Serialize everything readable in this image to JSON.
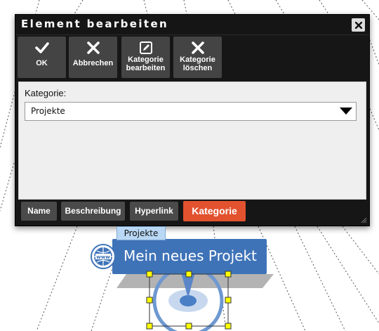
{
  "dialog": {
    "title": "Element bearbeiten",
    "toolbar": [
      {
        "label": "OK",
        "icon": "check-icon"
      },
      {
        "label": "Abbrechen",
        "icon": "cross-icon"
      },
      {
        "label_line1": "Kategorie",
        "label_line2": "bearbeiten",
        "icon": "edit-icon"
      },
      {
        "label_line1": "Kategorie",
        "label_line2": "löschen",
        "icon": "cross-icon"
      }
    ],
    "field": {
      "label": "Kategorie:",
      "value": "Projekte"
    },
    "tabs": [
      {
        "label": "Name"
      },
      {
        "label": "Beschreibung"
      },
      {
        "label": "Hyperlink"
      },
      {
        "label": "Kategorie",
        "active": true
      }
    ]
  },
  "canvas": {
    "category_tag": "Projekte",
    "node_title": "Mein neues Projekt",
    "node_icon": "www-globe-icon"
  },
  "colors": {
    "dialog_bg": "#161616",
    "button_bg": "#444444",
    "active_tab": "#e2522e",
    "node_blue": "#3f73b8",
    "tag_blue": "#b9d8f6",
    "handle_yellow": "#ffff00"
  }
}
